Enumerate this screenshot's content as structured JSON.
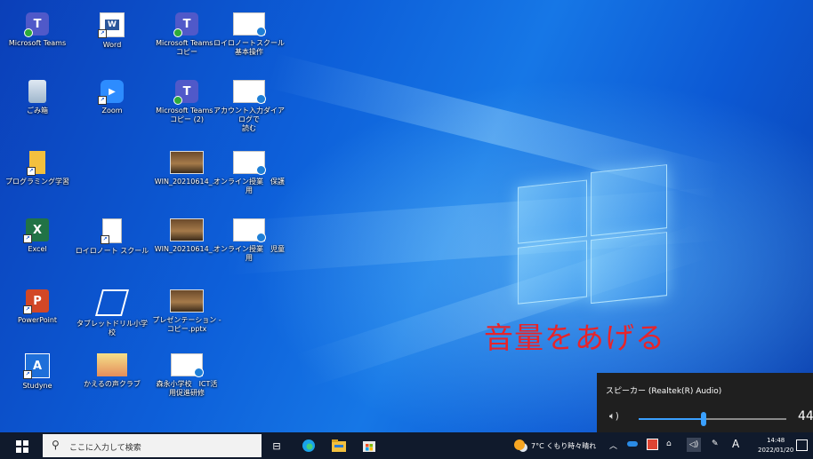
{
  "desktop": {
    "icons": [
      {
        "label": "Microsoft Teams",
        "type": "teams"
      },
      {
        "label": "Word",
        "type": "word"
      },
      {
        "label": "Microsoft Teams - \nコピー",
        "type": "teams"
      },
      {
        "label": "ロイロノートスクール\n基本操作",
        "type": "doc"
      },
      {
        "label": "ごみ箱",
        "type": "recycle"
      },
      {
        "label": "Zoom",
        "type": "zoom"
      },
      {
        "label": "Microsoft Teams - \nコピー (2)",
        "type": "teams"
      },
      {
        "label": "アカウント入力ダイアログで\n読む",
        "type": "doc"
      },
      {
        "label": "プログラミング学習",
        "type": "folder"
      },
      {
        "label": "WIN_20210614_...",
        "type": "photo"
      },
      {
        "label": "オンライン授業　保護\n用",
        "type": "doc"
      },
      {
        "label": "Excel",
        "type": "excel"
      },
      {
        "label": "ロイロノート スクール",
        "type": "file"
      },
      {
        "label": "WIN_20210614_...",
        "type": "photo"
      },
      {
        "label": "オンライン授業　児童\n用",
        "type": "doc"
      },
      {
        "label": "PowerPoint",
        "type": "ppt"
      },
      {
        "label": "タブレットドリル小学\n校",
        "type": "tabdrill"
      },
      {
        "label": "プレゼンテーション - \nコピー.pptx",
        "type": "photo"
      },
      {
        "label": "Studyne",
        "type": "studyne"
      },
      {
        "label": "かえるの声クラブ",
        "type": "kaeru"
      },
      {
        "label": "森永小学校　ICT活\n用促進研修",
        "type": "doc"
      }
    ],
    "overlay_text": "音量をあげる"
  },
  "volume_flyout": {
    "title": "スピーカー (Realtek(R) Audio)",
    "icon": "speaker-icon",
    "level": 44,
    "value_text": "44",
    "accent": "#3aa0ff"
  },
  "taskbar": {
    "search_placeholder": "ここに入力して検索",
    "apps": [
      "task-view-icon",
      "edge-icon",
      "file-explorer-icon",
      "store-icon"
    ],
    "weather": "7°C くもり時々晴れ",
    "tray_icons": [
      "chevron-up-icon",
      "onedrive-icon",
      "security-icon",
      "network-icon",
      "speaker-icon",
      "pen-icon"
    ],
    "ime": "A",
    "time": "14:48",
    "date": "2022/01/20"
  }
}
